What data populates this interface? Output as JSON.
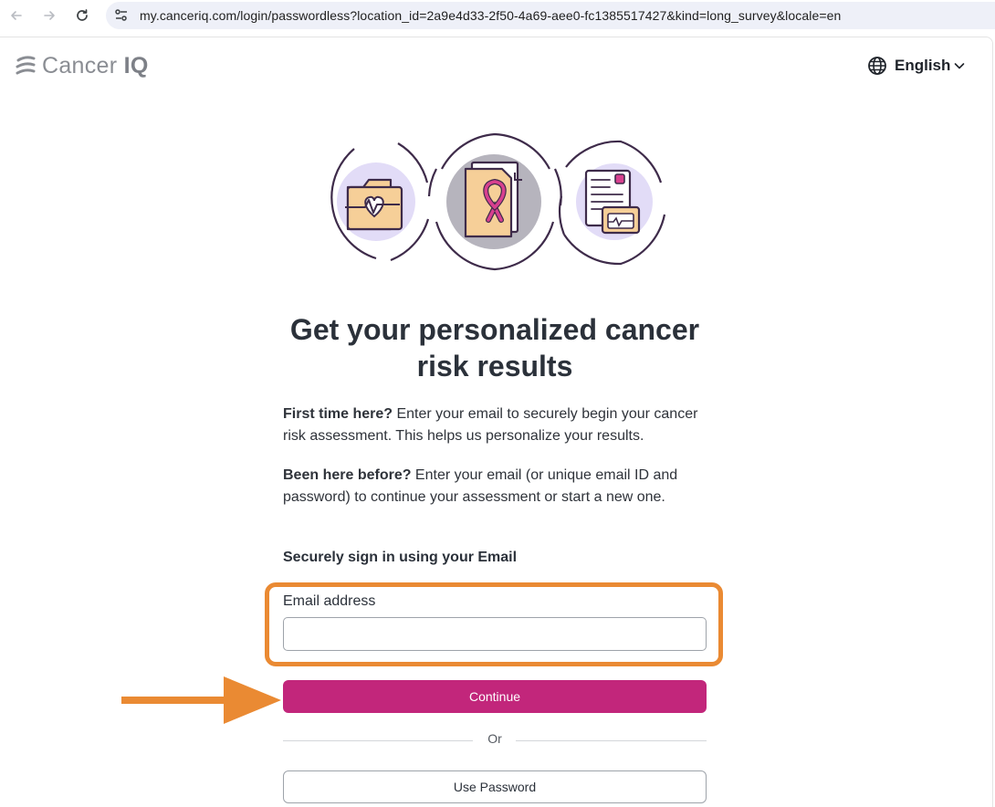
{
  "browser": {
    "back_icon": "arrow-left-icon",
    "forward_icon": "arrow-right-icon",
    "reload_icon": "reload-icon",
    "site_info_icon": "tune-icon",
    "url": "my.canceriq.com/login/passwordless?location_id=2a9e4d33-2f50-4a69-aee0-fc1385517427&kind=long_survey&locale=en"
  },
  "header": {
    "logo_text_light": "Cancer ",
    "logo_text_bold": "IQ",
    "language_label": "English",
    "language_icon": "globe-icon"
  },
  "main": {
    "title": "Get your personalized cancer risk results",
    "first_time_bold": "First time here?",
    "first_time_text": " Enter your email to securely begin your cancer risk assessment. This helps us personalize your results.",
    "returning_bold": "Been here before?",
    "returning_text": " Enter your email (or unique email ID and password) to continue your assessment or start a new one.",
    "signin_heading": "Securely sign in using your Email",
    "email_label": "Email address",
    "email_value": "",
    "email_placeholder": "",
    "continue_label": "Continue",
    "or_label": "Or",
    "password_label": "Use Password"
  },
  "annotations": {
    "highlight_color": "#ea8a33",
    "arrow_color": "#ea8a33"
  },
  "colors": {
    "primary_button": "#c2267b",
    "heading_text": "#2b313a",
    "illustration_ring": "#3e2b4a",
    "illustration_bubble": "#e2dcf7",
    "illustration_folder": "#f6cf98"
  }
}
